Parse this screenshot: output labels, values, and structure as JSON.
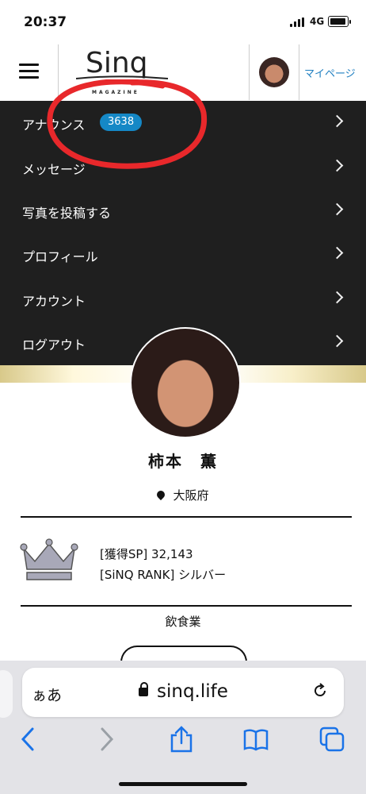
{
  "status_bar": {
    "time": "20:37",
    "network": "4G"
  },
  "header": {
    "logo": "Sinq",
    "logo_sub": "MAGAZINE",
    "mypage_label": "マイページ"
  },
  "menu": {
    "items": [
      {
        "label": "アナウンス",
        "badge": "3638"
      },
      {
        "label": "メッセージ"
      },
      {
        "label": "写真を投稿する"
      },
      {
        "label": "プロフィール"
      },
      {
        "label": "アカウント"
      },
      {
        "label": "ログアウト"
      }
    ]
  },
  "profile": {
    "name": "柿本　薫",
    "location": "大阪府",
    "sp_line": "[獲得SP] 32,143",
    "rank_line": "[SiNQ RANK] シルバー",
    "industry": "飲食業"
  },
  "browser": {
    "text_size_label": "ぁあ",
    "domain": "sinq.life"
  },
  "icons": {
    "menu": "hamburger-icon",
    "chevron": "chevron-right-icon",
    "location": "location-pin-icon",
    "rank": "crown-icon",
    "lock": "lock-icon",
    "reload": "reload-icon",
    "back": "back-icon",
    "forward": "forward-icon",
    "share": "share-icon",
    "bookmarks": "bookmarks-icon",
    "tabs": "tabs-icon"
  },
  "colors": {
    "menu_bg": "#1f1f1f",
    "badge": "#1588c6",
    "link": "#1f7fc1",
    "crown": "#a8a8b8",
    "annotation": "#e8282b"
  }
}
